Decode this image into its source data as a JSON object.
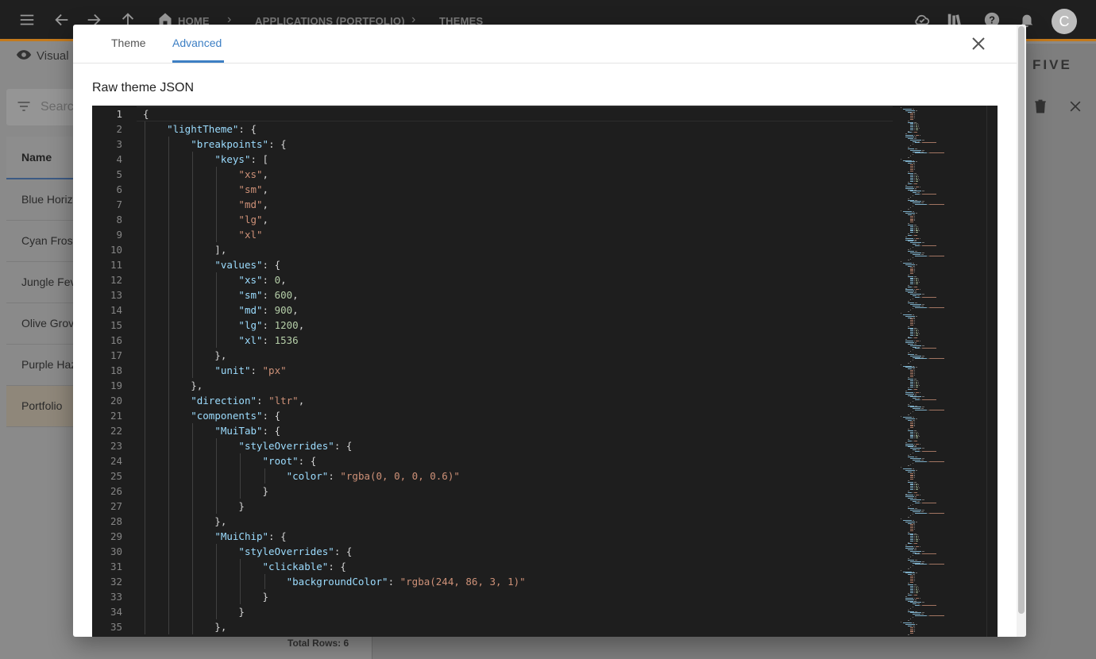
{
  "topbar": {
    "breadcrumbs": [
      "HOME",
      "APPLICATIONS (PORTFOLIO)",
      "THEMES"
    ],
    "avatar_letter": "C"
  },
  "background": {
    "view_label": "Visual",
    "search_placeholder": "Search",
    "column_header": "Name",
    "rows": [
      "Blue Horiz",
      "Cyan Frost",
      "Jungle Fev",
      "Olive Grov",
      "Purple Haz",
      "Portfolio"
    ],
    "selected_row": "Portfolio",
    "total_rows": "Total Rows: 6",
    "brand": "FIVE"
  },
  "modal": {
    "tabs": [
      {
        "label": "Theme",
        "active": false
      },
      {
        "label": "Advanced",
        "active": true
      }
    ],
    "section_label": "Raw theme JSON",
    "editor": {
      "current_line": 1,
      "lines": [
        [
          [
            "p",
            "{"
          ]
        ],
        [
          [
            "p",
            "    "
          ],
          [
            "k",
            "\"lightTheme\""
          ],
          [
            "p",
            ": {"
          ]
        ],
        [
          [
            "p",
            "        "
          ],
          [
            "k",
            "\"breakpoints\""
          ],
          [
            "p",
            ": {"
          ]
        ],
        [
          [
            "p",
            "            "
          ],
          [
            "k",
            "\"keys\""
          ],
          [
            "p",
            ": ["
          ]
        ],
        [
          [
            "p",
            "                "
          ],
          [
            "s",
            "\"xs\""
          ],
          [
            "p",
            ","
          ]
        ],
        [
          [
            "p",
            "                "
          ],
          [
            "s",
            "\"sm\""
          ],
          [
            "p",
            ","
          ]
        ],
        [
          [
            "p",
            "                "
          ],
          [
            "s",
            "\"md\""
          ],
          [
            "p",
            ","
          ]
        ],
        [
          [
            "p",
            "                "
          ],
          [
            "s",
            "\"lg\""
          ],
          [
            "p",
            ","
          ]
        ],
        [
          [
            "p",
            "                "
          ],
          [
            "s",
            "\"xl\""
          ]
        ],
        [
          [
            "p",
            "            ],"
          ]
        ],
        [
          [
            "p",
            "            "
          ],
          [
            "k",
            "\"values\""
          ],
          [
            "p",
            ": {"
          ]
        ],
        [
          [
            "p",
            "                "
          ],
          [
            "k",
            "\"xs\""
          ],
          [
            "p",
            ": "
          ],
          [
            "n",
            "0"
          ],
          [
            "p",
            ","
          ]
        ],
        [
          [
            "p",
            "                "
          ],
          [
            "k",
            "\"sm\""
          ],
          [
            "p",
            ": "
          ],
          [
            "n",
            "600"
          ],
          [
            "p",
            ","
          ]
        ],
        [
          [
            "p",
            "                "
          ],
          [
            "k",
            "\"md\""
          ],
          [
            "p",
            ": "
          ],
          [
            "n",
            "900"
          ],
          [
            "p",
            ","
          ]
        ],
        [
          [
            "p",
            "                "
          ],
          [
            "k",
            "\"lg\""
          ],
          [
            "p",
            ": "
          ],
          [
            "n",
            "1200"
          ],
          [
            "p",
            ","
          ]
        ],
        [
          [
            "p",
            "                "
          ],
          [
            "k",
            "\"xl\""
          ],
          [
            "p",
            ": "
          ],
          [
            "n",
            "1536"
          ]
        ],
        [
          [
            "p",
            "            },"
          ]
        ],
        [
          [
            "p",
            "            "
          ],
          [
            "k",
            "\"unit\""
          ],
          [
            "p",
            ": "
          ],
          [
            "s",
            "\"px\""
          ]
        ],
        [
          [
            "p",
            "        },"
          ]
        ],
        [
          [
            "p",
            "        "
          ],
          [
            "k",
            "\"direction\""
          ],
          [
            "p",
            ": "
          ],
          [
            "s",
            "\"ltr\""
          ],
          [
            "p",
            ","
          ]
        ],
        [
          [
            "p",
            "        "
          ],
          [
            "k",
            "\"components\""
          ],
          [
            "p",
            ": {"
          ]
        ],
        [
          [
            "p",
            "            "
          ],
          [
            "k",
            "\"MuiTab\""
          ],
          [
            "p",
            ": {"
          ]
        ],
        [
          [
            "p",
            "                "
          ],
          [
            "k",
            "\"styleOverrides\""
          ],
          [
            "p",
            ": {"
          ]
        ],
        [
          [
            "p",
            "                    "
          ],
          [
            "k",
            "\"root\""
          ],
          [
            "p",
            ": {"
          ]
        ],
        [
          [
            "p",
            "                        "
          ],
          [
            "k",
            "\"color\""
          ],
          [
            "p",
            ": "
          ],
          [
            "s",
            "\"rgba(0, 0, 0, 0.6)\""
          ]
        ],
        [
          [
            "p",
            "                    }"
          ]
        ],
        [
          [
            "p",
            "                }"
          ]
        ],
        [
          [
            "p",
            "            },"
          ]
        ],
        [
          [
            "p",
            "            "
          ],
          [
            "k",
            "\"MuiChip\""
          ],
          [
            "p",
            ": {"
          ]
        ],
        [
          [
            "p",
            "                "
          ],
          [
            "k",
            "\"styleOverrides\""
          ],
          [
            "p",
            ": {"
          ]
        ],
        [
          [
            "p",
            "                    "
          ],
          [
            "k",
            "\"clickable\""
          ],
          [
            "p",
            ": {"
          ]
        ],
        [
          [
            "p",
            "                        "
          ],
          [
            "k",
            "\"backgroundColor\""
          ],
          [
            "p",
            ": "
          ],
          [
            "s",
            "\"rgba(244, 86, 3, 1)\""
          ]
        ],
        [
          [
            "p",
            "                    }"
          ]
        ],
        [
          [
            "p",
            "                }"
          ]
        ],
        [
          [
            "p",
            "            },"
          ]
        ]
      ]
    }
  },
  "colors": {
    "accent": "#3d7fc4",
    "editor_bg": "#1e1e1e",
    "json_key": "#9cdcfe",
    "json_string": "#ce9178",
    "json_number": "#b5cea8"
  }
}
